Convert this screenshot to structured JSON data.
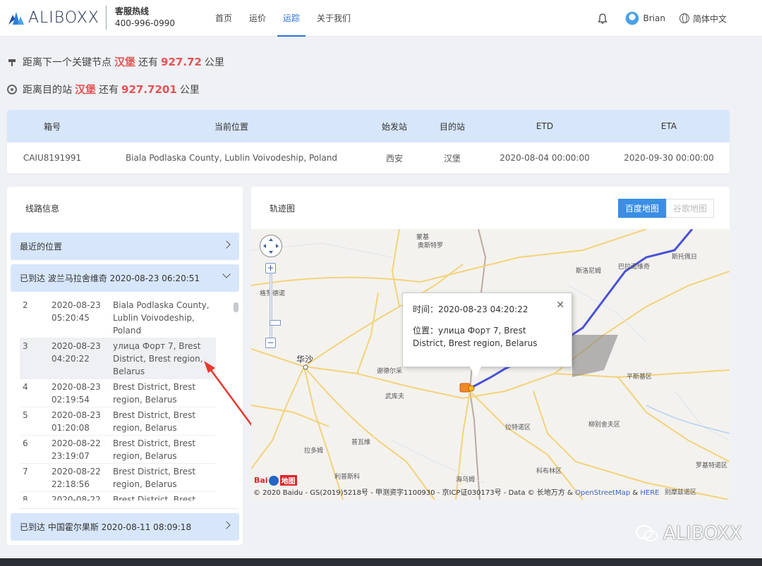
{
  "header": {
    "logo_text": "ALIBOXX",
    "hotline_label": "客服热线",
    "hotline_number": "400-996-0990",
    "nav": [
      {
        "label": "首页",
        "active": false
      },
      {
        "label": "运价",
        "active": false
      },
      {
        "label": "运踪",
        "active": true
      },
      {
        "label": "关于我们",
        "active": false
      }
    ],
    "user_name": "Brian",
    "language": "简体中文"
  },
  "info": {
    "next_node_prefix": "距离下一个关键节点",
    "next_node_city": "汉堡",
    "next_node_mid": "还有",
    "next_node_distance": "927.72",
    "next_node_unit": "公里",
    "dest_prefix": "距离目的站",
    "dest_city": "汉堡",
    "dest_mid": "还有",
    "dest_distance": "927.7201",
    "dest_unit": "公里"
  },
  "container_table": {
    "headers": [
      "箱号",
      "当前位置",
      "始发站",
      "目的站",
      "ETD",
      "ETA"
    ],
    "row": [
      "CAIU8191991",
      "Biala Podlaska County, Lublin Voivodeship, Poland",
      "西安",
      "汉堡",
      "2020-08-04 00:00:00",
      "2020-09-30 00:00:00"
    ]
  },
  "route_panel": {
    "title": "线路信息",
    "latest_label": "最近的位置",
    "arrived1": "已到达 波兰马拉舍维奇 2020-08-23 06:20:51",
    "arrived2": "已到达 中国霍尔果斯 2020-08-11 08:09:18",
    "items": [
      {
        "n": "2",
        "date": "2020-08-23",
        "time": "05:20:45",
        "place": "Biala Podlaska County, Lublin Voivodeship, Poland"
      },
      {
        "n": "3",
        "date": "2020-08-23",
        "time": "04:20:22",
        "place": "улица Форт 7, Brest District, Brest region, Belarus"
      },
      {
        "n": "4",
        "date": "2020-08-23",
        "time": "02:19:54",
        "place": "Brest District, Brest region, Belarus"
      },
      {
        "n": "5",
        "date": "2020-08-23",
        "time": "01:20:08",
        "place": "Brest District, Brest region, Belarus"
      },
      {
        "n": "6",
        "date": "2020-08-22",
        "time": "23:19:07",
        "place": "Brest District, Brest region, Belarus"
      },
      {
        "n": "7",
        "date": "2020-08-22",
        "time": "22:18:56",
        "place": "Brest District, Brest region, Belarus"
      },
      {
        "n": "8",
        "date": "2020-08-22",
        "time": "",
        "place": "Brest District, Brest"
      }
    ]
  },
  "map_panel": {
    "title": "轨迹图",
    "btn_baidu": "百度地图",
    "btn_google": "谷歌地图",
    "popup_time_label": "时间：",
    "popup_time": "2020-08-23 04:20:22",
    "popup_pos_label": "位置：",
    "popup_pos": "улица Форт 7, Brest District, Brest region, Belarus",
    "copyright_prefix": "© 2020 Baidu - GS(2019)5218号 - 甲测资字1100930 - 京ICP证030173号 - Data © 长地万方 &",
    "copyright_osm": "OpenStreetMap",
    "copyright_amp": "&",
    "copyright_here": "HERE",
    "baidu_logo_a": "Bai",
    "baidu_logo_b": "地图",
    "place_labels": [
      {
        "text": "华沙"
      },
      {
        "text": "蒙基"
      },
      {
        "text": "谢德尔采"
      },
      {
        "text": "武库夫"
      },
      {
        "text": "拉多姆"
      },
      {
        "text": "普瓦维"
      },
      {
        "text": "利普斯科"
      },
      {
        "text": "海乌姆"
      },
      {
        "text": "科布林区"
      },
      {
        "text": "柳别舍夫区"
      },
      {
        "text": "拉特诺区"
      },
      {
        "text": "平斯基区"
      },
      {
        "text": "斯洛尼姆"
      },
      {
        "text": "巴拉诺维奇"
      },
      {
        "text": "斯托佩日"
      },
      {
        "text": "格罗德诺"
      },
      {
        "text": "罗基特诺区"
      },
      {
        "text": "别摩兹诺区"
      },
      {
        "text": "奥斯特罗"
      }
    ]
  },
  "watermark": "ALIBOXX",
  "colors": {
    "accent": "#3a8ee6",
    "highlight": "#e65151",
    "table_header": "#d7e6fb",
    "route_line": "#4a52d8",
    "annotation_arrow": "#e8382e"
  }
}
